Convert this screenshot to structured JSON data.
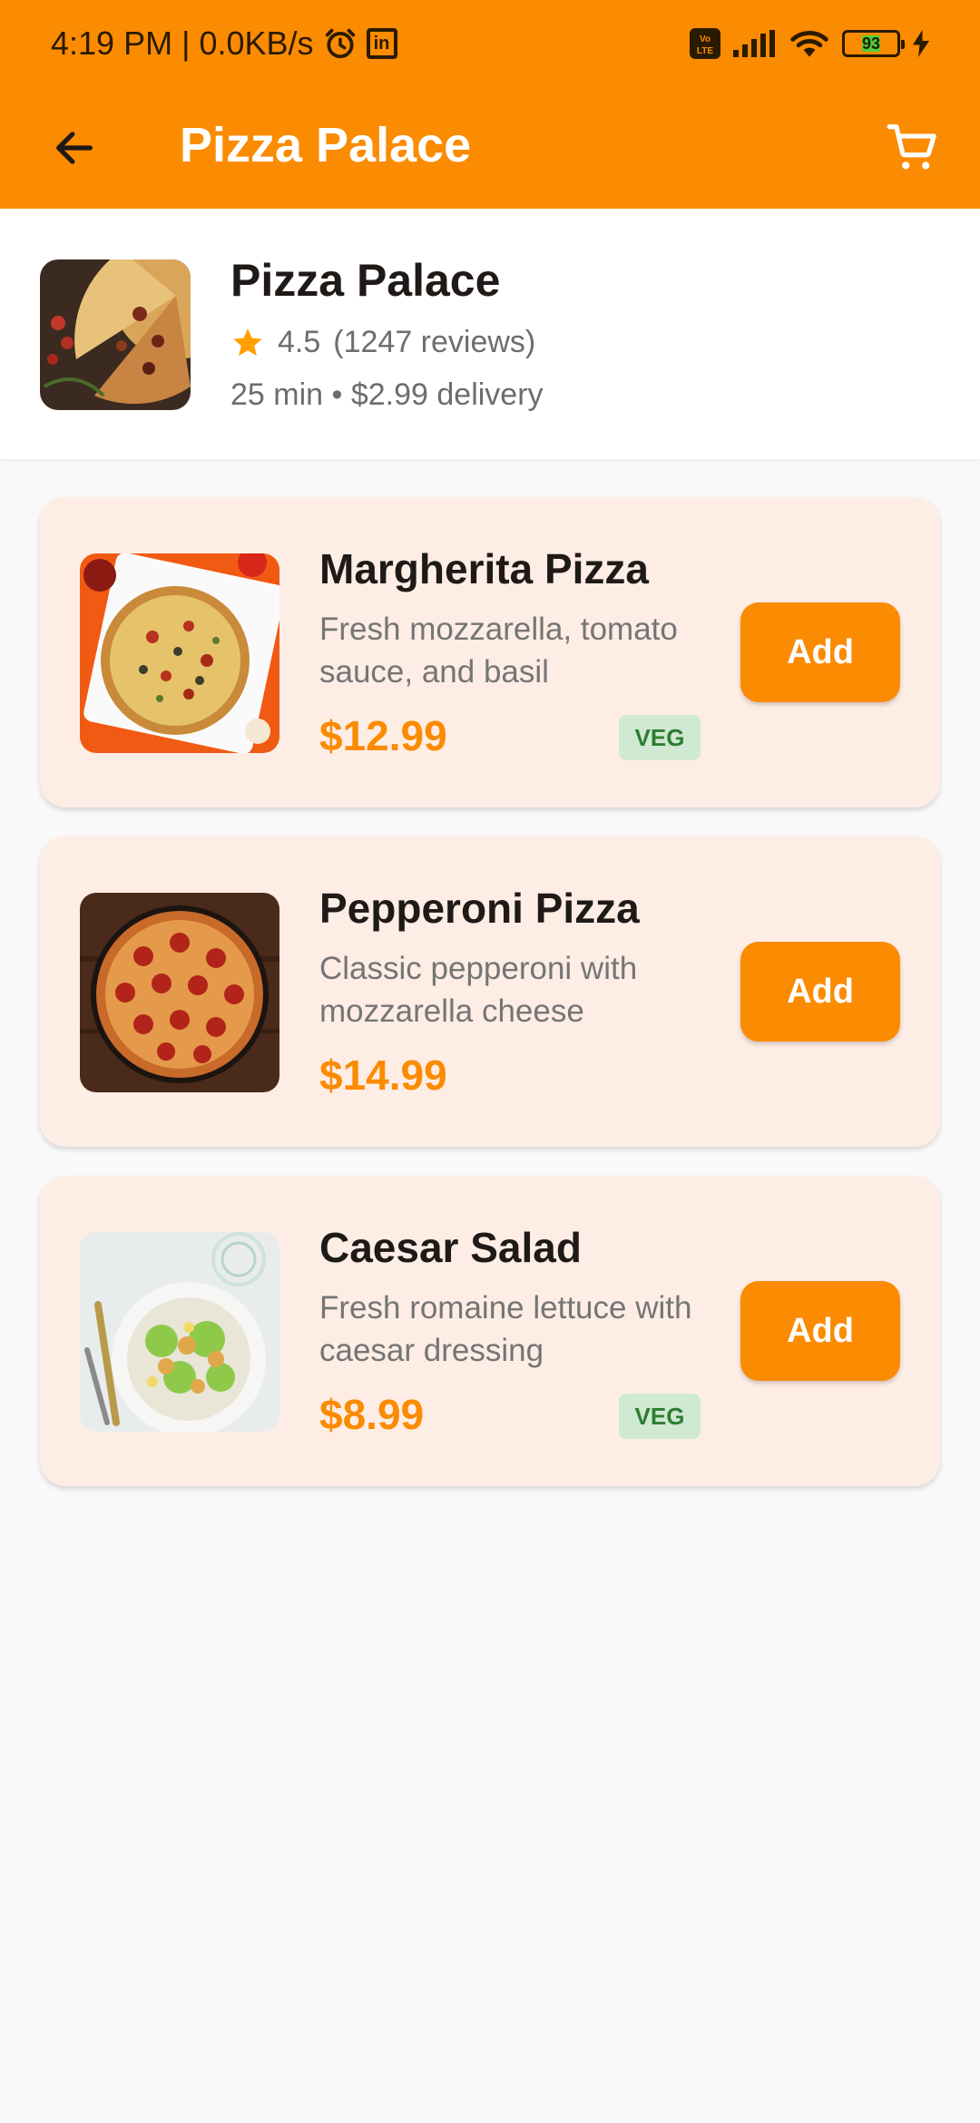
{
  "status_bar": {
    "time": "4:19 PM",
    "separator": "|",
    "net_speed": "0.0KB/s",
    "battery_level": "93",
    "icons": [
      "alarm-icon",
      "linkedin-icon",
      "volte-icon",
      "signal-icon",
      "wifi-icon",
      "battery-icon",
      "charging-icon"
    ]
  },
  "app_bar": {
    "title": "Pizza Palace",
    "back_icon": "arrow-left-icon",
    "cart_icon": "shopping-cart-icon",
    "background": "#fb8b01"
  },
  "restaurant": {
    "name": "Pizza Palace",
    "rating": "4.5",
    "reviews": "(1247 reviews)",
    "meta": "25 min • $2.99 delivery",
    "star_color": "#ffa000"
  },
  "menu": {
    "items": [
      {
        "name": "Margherita Pizza",
        "description": "Fresh mozzarella, tomato sauce, and basil",
        "price": "$12.99",
        "badge": "VEG",
        "add_label": "Add"
      },
      {
        "name": "Pepperoni Pizza",
        "description": "Classic pepperoni with mozzarella cheese",
        "price": "$14.99",
        "badge": "",
        "add_label": "Add"
      },
      {
        "name": "Caesar Salad",
        "description": "Fresh romaine lettuce with caesar dressing",
        "price": "$8.99",
        "badge": "VEG",
        "add_label": "Add"
      }
    ]
  },
  "colors": {
    "accent": "#fb8b01",
    "card_bg": "#feede5",
    "veg_badge_bg": "#cfe9d2",
    "veg_badge_text": "#2e7d32"
  }
}
